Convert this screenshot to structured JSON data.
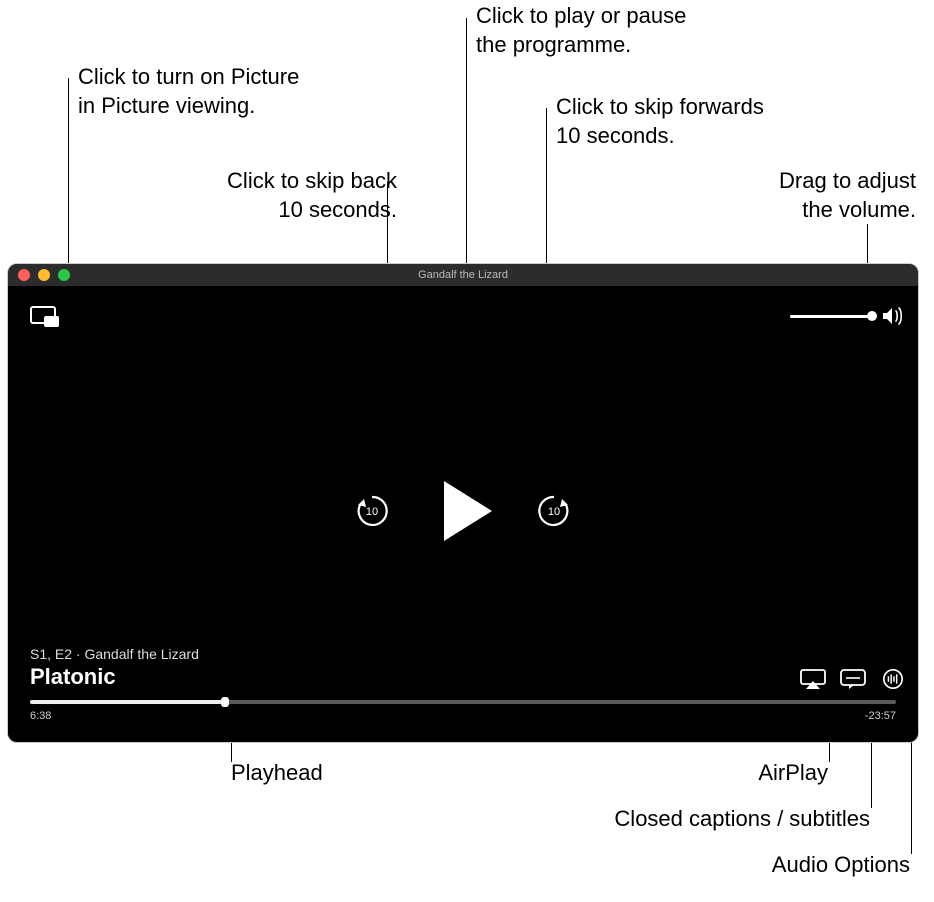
{
  "callouts": {
    "pip": "Click to turn on Picture\nin Picture viewing.",
    "skip_back": "Click to skip back\n10 seconds.",
    "play_pause": "Click to play or pause\nthe programme.",
    "skip_fwd": "Click to skip forwards\n10 seconds.",
    "volume": "Drag to adjust\nthe volume.",
    "playhead": "Playhead",
    "airplay": "AirPlay",
    "captions": "Closed captions / subtitles",
    "audio_opts": "Audio Options"
  },
  "window": {
    "title": "Gandalf the Lizard"
  },
  "player": {
    "episode": "S1, E2 · Gandalf the Lizard",
    "show": "Platonic",
    "elapsed": "6:38",
    "remaining": "-23:57",
    "skip_amount": "10",
    "progress_pct": 22.5,
    "volume_pct": 100
  }
}
